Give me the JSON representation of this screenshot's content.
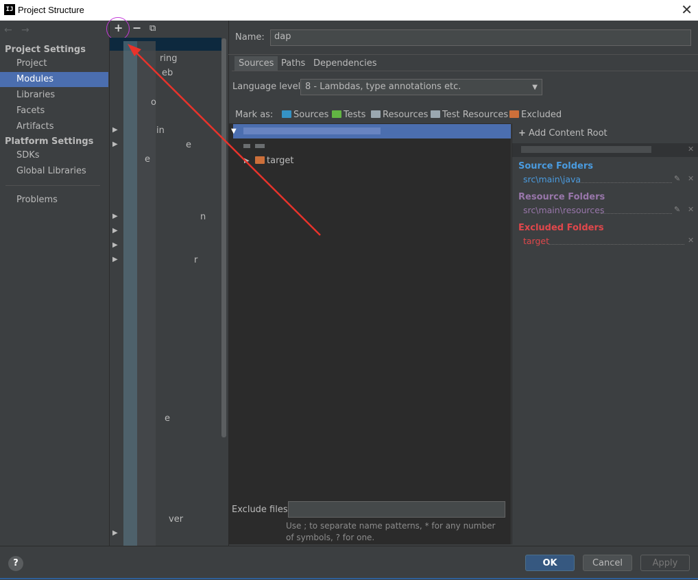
{
  "window": {
    "title": "Project Structure",
    "app_logo": "IJ",
    "close_icon": "close-icon"
  },
  "nav": {
    "back_icon": "arrow-left-icon",
    "forward_icon": "arrow-right-icon",
    "project_settings_heading": "Project Settings",
    "project_items": [
      "Project",
      "Modules",
      "Libraries",
      "Facets",
      "Artifacts"
    ],
    "selected": "Modules",
    "platform_settings_heading": "Platform Settings",
    "platform_items": [
      "SDKs",
      "Global Libraries"
    ],
    "problems": "Problems"
  },
  "module_list": {
    "add_icon": "+",
    "remove_icon": "−",
    "copy_icon": "copy-icon",
    "visible_fragments": [
      "ring",
      "eb",
      "o",
      "in",
      "e",
      "e",
      "n",
      "r",
      "e",
      "ver"
    ]
  },
  "module": {
    "name_label": "Name:",
    "name_value": "dap",
    "tabs": [
      "Sources",
      "Paths",
      "Dependencies"
    ],
    "active_tab": "Sources",
    "language_level_label": "Language level:",
    "language_level_value": "8 - Lambdas, type annotations etc.",
    "mark_as_label": "Mark as:",
    "mark_as": [
      {
        "label": "Sources",
        "color": "#3592c4"
      },
      {
        "label": "Tests",
        "color": "#62b543"
      },
      {
        "label": "Resources",
        "color": "#9aa7b0"
      },
      {
        "label": "Test Resources",
        "color": "#9aa7b0"
      },
      {
        "label": "Excluded",
        "color": "#cc6f3a"
      }
    ],
    "tree": {
      "selected_root": "",
      "child": "target"
    },
    "exclude_files_label": "Exclude files:",
    "exclude_files_value": "",
    "exclude_hint": "Use ; to separate name patterns, * for any number of symbols, ? for one."
  },
  "content_root": {
    "add_label": "Add Content Root",
    "source_folders_title": "Source Folders",
    "source_folders": [
      "src\\main\\java"
    ],
    "resource_folders_title": "Resource Folders",
    "resource_folders": [
      "src\\main\\resources"
    ],
    "excluded_folders_title": "Excluded Folders",
    "excluded_folders": [
      "target"
    ],
    "colors": {
      "source": "#4a9bdf",
      "resource": "#9876aa",
      "excluded": "#e0474b"
    }
  },
  "footer": {
    "help": "?",
    "ok": "OK",
    "cancel": "Cancel",
    "apply": "Apply"
  }
}
